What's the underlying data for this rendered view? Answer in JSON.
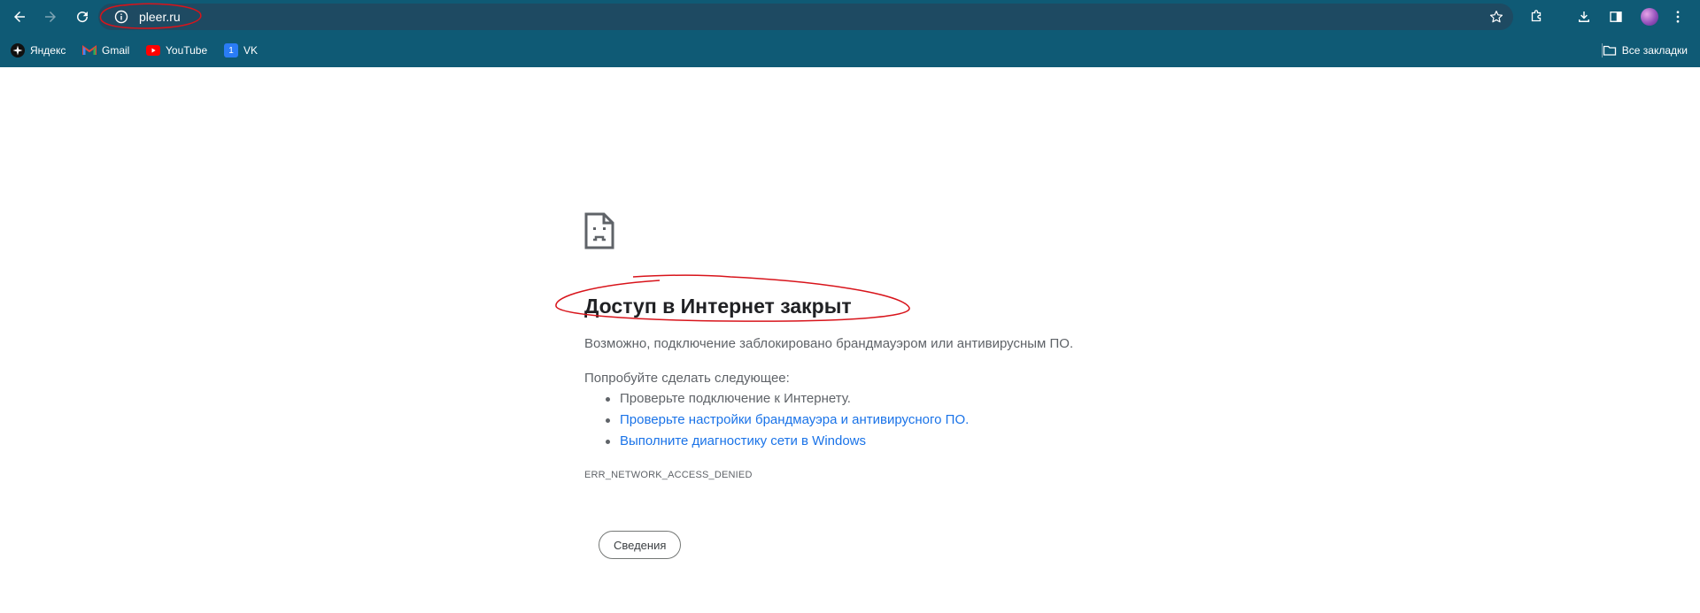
{
  "browser": {
    "url": "pleer.ru",
    "bookmarks": [
      {
        "label": "Яндекс",
        "icon": "yandex-icon"
      },
      {
        "label": "Gmail",
        "icon": "gmail-icon"
      },
      {
        "label": "YouTube",
        "icon": "youtube-icon"
      },
      {
        "label": "VK",
        "icon": "vk-icon",
        "badge": "1"
      }
    ],
    "all_bookmarks_label": "Все закладки"
  },
  "error": {
    "icon": "sad-document-icon",
    "title": "Доступ в Интернет закрыт",
    "description": "Возможно, подключение заблокировано брандмауэром или антивирусным ПО.",
    "try_heading": "Попробуйте сделать следующее:",
    "suggestions": [
      "Проверьте подключение к Интернету.",
      "Проверьте настройки брандмауэра и антивирусного ПО.",
      "Выполните диагностику сети в Windows"
    ],
    "code": "ERR_NETWORK_ACCESS_DENIED",
    "details_button": "Сведения"
  },
  "colors": {
    "toolbar": "#0f5a75",
    "omnibox": "#1e4a62",
    "link": "#1a73e8",
    "annotation": "#d8141b"
  }
}
